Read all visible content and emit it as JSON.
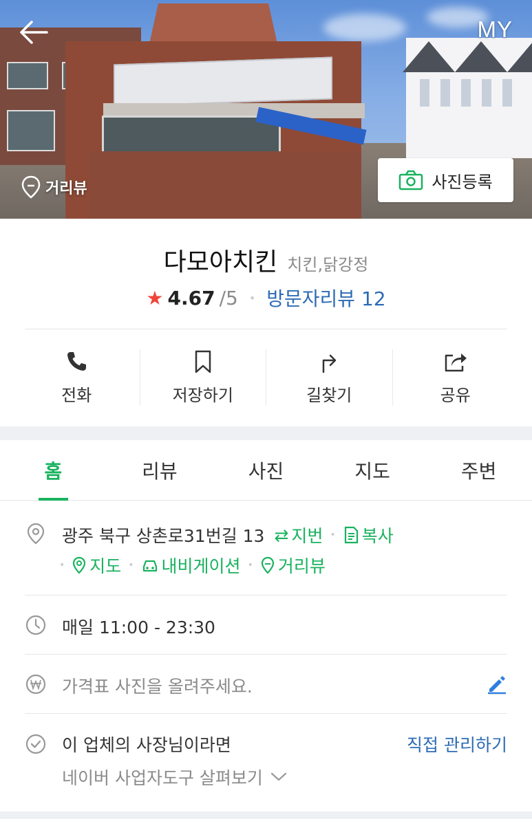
{
  "hero": {
    "my_label": "MY",
    "streetview_label": "거리뷰",
    "photo_register_label": "사진등록"
  },
  "place": {
    "name": "다모아치킨",
    "category": "치킨,닭강정",
    "rating": "4.67",
    "rating_max": "/5",
    "visitor_review_label": "방문자리뷰 12"
  },
  "actions": [
    {
      "label": "전화",
      "icon": "phone-icon"
    },
    {
      "label": "저장하기",
      "icon": "bookmark-icon"
    },
    {
      "label": "길찾기",
      "icon": "directions-icon"
    },
    {
      "label": "공유",
      "icon": "share-icon"
    }
  ],
  "tabs": [
    {
      "label": "홈",
      "active": true
    },
    {
      "label": "리뷰",
      "active": false
    },
    {
      "label": "사진",
      "active": false
    },
    {
      "label": "지도",
      "active": false
    },
    {
      "label": "주변",
      "active": false
    }
  ],
  "address": {
    "text": "광주 북구 상촌로31번길 13",
    "jibun_label": "지번",
    "copy_label": "복사",
    "map_label": "지도",
    "navigation_label": "내비게이션",
    "streetview_label": "거리뷰"
  },
  "hours": {
    "text": "매일 11:00 - 23:30"
  },
  "price": {
    "text": "가격표 사진을 올려주세요."
  },
  "owner": {
    "text": "이 업체의 사장님이라면",
    "manage_label": "직접 관리하기",
    "tools_label": "네이버 사업자도구 살펴보기"
  },
  "colors": {
    "accent_green": "#19b25e",
    "link_blue": "#2d6bb5",
    "star_red": "#f0453a"
  }
}
